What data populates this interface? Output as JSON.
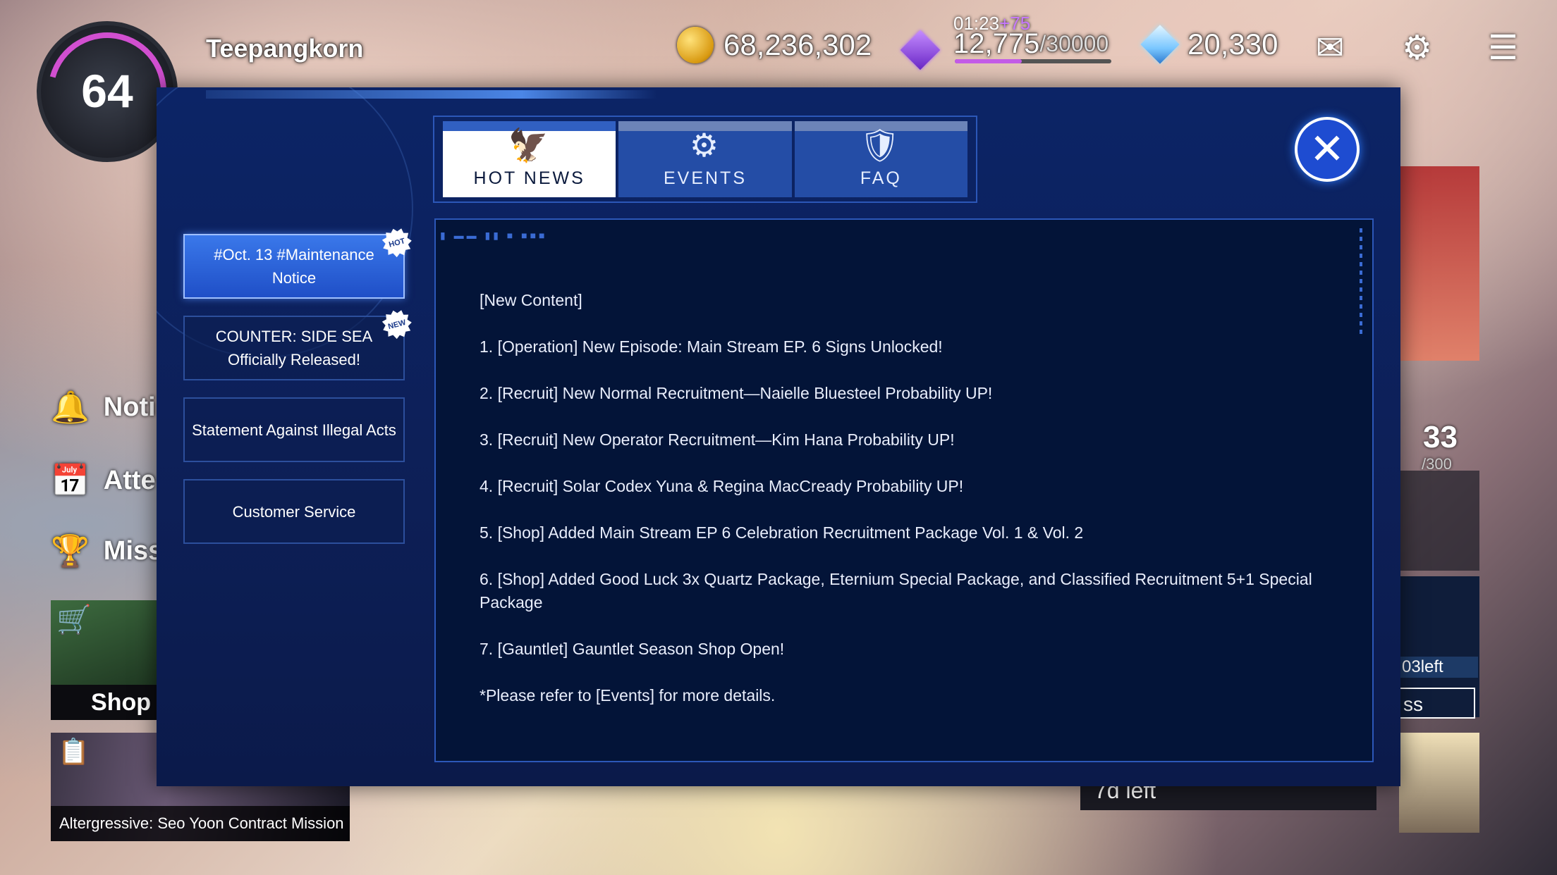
{
  "hud": {
    "level": "64",
    "player_name": "Teepangkorn",
    "gold": "68,236,302",
    "stamina_timer": "01:23",
    "stamina_plus": "+75",
    "stamina_value": "12,775",
    "stamina_max": "/30000",
    "stamina_fraction": 0.43,
    "crystals": "20,330",
    "icons": [
      "coin-icon",
      "stamina-gem-icon",
      "diamond-icon",
      "mail-icon",
      "settings-icon",
      "menu-icon"
    ]
  },
  "left_menu": {
    "notice_label": "Noti",
    "attendance_label": "Atte",
    "mission_label": "Miss",
    "shop_label": "Shop",
    "banner_label": "Altergressive: Seo Yoon Contract Mission"
  },
  "right_hud": {
    "count": "33",
    "count_max": "/300",
    "left_text": "03left",
    "pass_text": "ss",
    "bottom_timer": "7d left"
  },
  "modal": {
    "tabs": [
      {
        "label": "HOT NEWS",
        "active": true,
        "icon": "eagle-icon"
      },
      {
        "label": "EVENTS",
        "active": false,
        "icon": "gear-target-icon"
      },
      {
        "label": "FAQ",
        "active": false,
        "icon": "shield-wings-icon"
      }
    ],
    "sidebar": [
      {
        "label": "#Oct. 13 #Maintenance Notice",
        "badge": "HOT",
        "active": true
      },
      {
        "label": "COUNTER: SIDE SEA Officially Released!",
        "badge": "NEW",
        "active": false
      },
      {
        "label": "Statement Against Illegal Acts",
        "badge": "",
        "active": false
      },
      {
        "label": "Customer Service",
        "badge": "",
        "active": false
      }
    ],
    "content": [
      "[New Content]",
      "1. [Operation] New Episode: Main Stream EP. 6 Signs Unlocked!",
      "2. [Recruit] New Normal Recruitment—Naielle Bluesteel Probability UP!",
      "3. [Recruit] New Operator Recruitment—Kim Hana Probability UP!",
      "4. [Recruit] Solar Codex Yuna & Regina MacCready Probability UP!",
      "5. [Shop] Added Main Stream EP 6 Celebration Recruitment Package Vol. 1 & Vol. 2",
      "6. [Shop] Added Good Luck 3x Quartz Package, Eternium Special Package, and Classified Recruitment 5+1 Special Package",
      "7. [Gauntlet] Gauntlet Season Shop Open!",
      "*Please refer to [Events] for more details."
    ]
  }
}
